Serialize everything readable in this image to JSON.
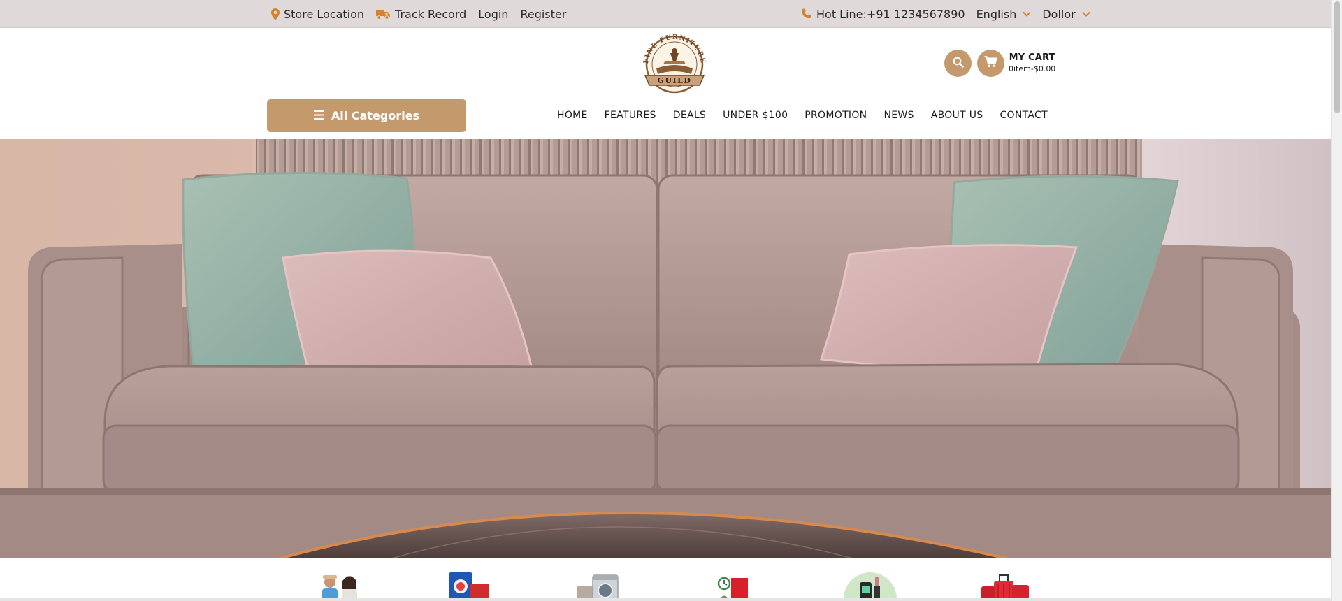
{
  "topbar": {
    "store_location": "Store Location",
    "track_record": "Track Record",
    "login": "Login",
    "register": "Register",
    "hotline": "Hot Line:+91 1234567890",
    "language": "English",
    "currency": "Dollor"
  },
  "brand": {
    "name": "FINE FURNITURE GUILD",
    "accent_color": "#c49a6c",
    "topbar_color": "#e0d9d9"
  },
  "cart": {
    "title": "MY CART",
    "summary": "0item-$0.00"
  },
  "categories_button": {
    "label": "All Categories",
    "icon": "hamburger-icon"
  },
  "nav": {
    "items": [
      {
        "label": "HOME"
      },
      {
        "label": "FEATURES"
      },
      {
        "label": "DEALS"
      },
      {
        "label": "UNDER $100"
      },
      {
        "label": "PROMOTION"
      },
      {
        "label": "NEWS"
      },
      {
        "label": "ABOUT US"
      },
      {
        "label": "CONTACT"
      }
    ]
  },
  "hero": {
    "image": "velvet-sofa-with-pillows"
  },
  "category_strip": {
    "items": [
      {
        "icon": "fashion-people-icon"
      },
      {
        "icon": "grocery-box-icon"
      },
      {
        "icon": "washing-machine-icon"
      },
      {
        "icon": "home-decor-icon"
      },
      {
        "icon": "beauty-cosmetics-icon"
      },
      {
        "icon": "luggage-icon"
      }
    ]
  }
}
